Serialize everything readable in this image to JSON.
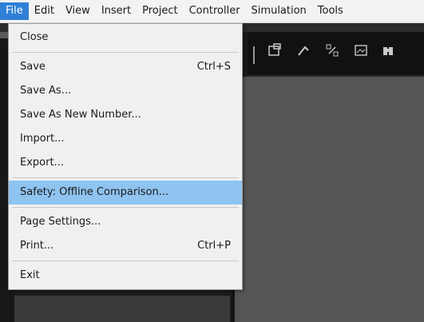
{
  "menubar": {
    "items": [
      {
        "label": "File"
      },
      {
        "label": "Edit"
      },
      {
        "label": "View"
      },
      {
        "label": "Insert"
      },
      {
        "label": "Project"
      },
      {
        "label": "Controller"
      },
      {
        "label": "Simulation"
      },
      {
        "label": "Tools"
      }
    ]
  },
  "file_menu": {
    "close": {
      "label": "Close"
    },
    "save": {
      "label": "Save",
      "shortcut": "Ctrl+S"
    },
    "save_as": {
      "label": "Save As..."
    },
    "save_as_new_number": {
      "label": "Save As New Number..."
    },
    "import": {
      "label": "Import..."
    },
    "export": {
      "label": "Export..."
    },
    "safety_offline_comparison": {
      "label": "Safety: Offline Comparison..."
    },
    "page_settings": {
      "label": "Page Settings..."
    },
    "print": {
      "label": "Print...",
      "shortcut": "Ctrl+P"
    },
    "exit": {
      "label": "Exit"
    }
  },
  "toolbar": {
    "icons": [
      "window-icon",
      "build-icon",
      "compare-icon",
      "image-icon",
      "binoculars-icon"
    ]
  },
  "colors": {
    "menu_active": "#2f7fd6",
    "menu_highlight": "#8fc3f0",
    "dark_bg": "#1b1b1b",
    "pane_gray": "#555555"
  }
}
